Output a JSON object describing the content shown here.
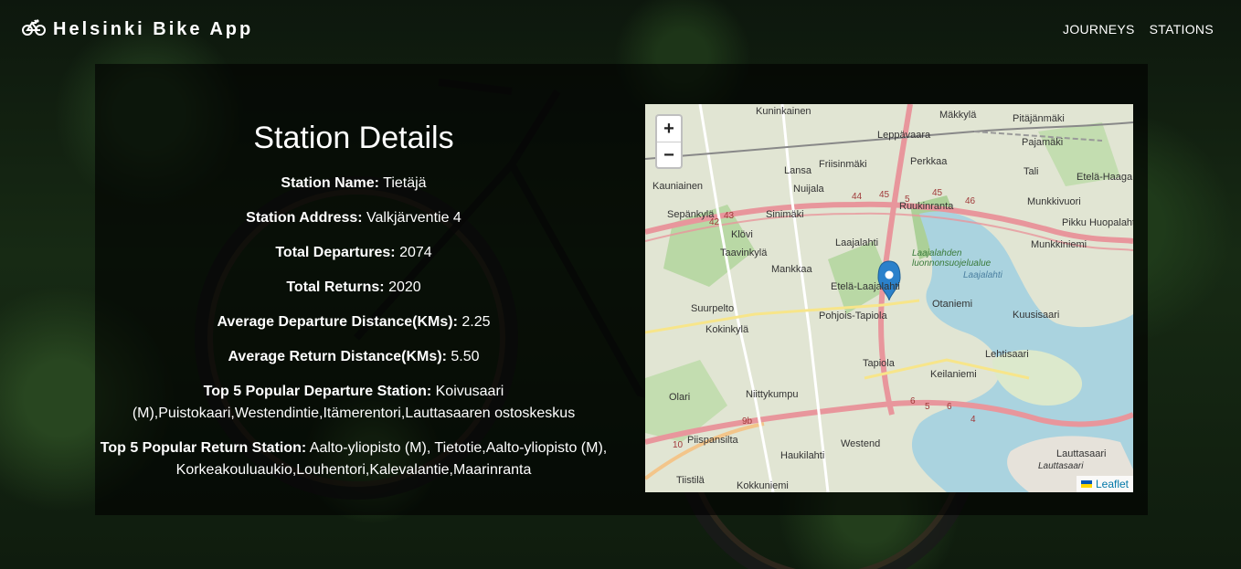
{
  "app": {
    "title": "Helsinki Bike App",
    "nav": [
      "JOURNEYS",
      "STATIONS"
    ]
  },
  "details": {
    "heading": "Station Details",
    "rows": [
      {
        "label": "Station Name:",
        "value": "Tietäjä"
      },
      {
        "label": "Station Address:",
        "value": "Valkjärventie 4"
      },
      {
        "label": "Total Departures:",
        "value": "2074"
      },
      {
        "label": "Total Returns:",
        "value": "2020"
      },
      {
        "label": "Average Departure Distance(KMs):",
        "value": "2.25"
      },
      {
        "label": "Average Return Distance(KMs):",
        "value": "5.50"
      },
      {
        "label": "Top 5 Popular Departure Station:",
        "value": "Koivusaari (M),Puistokaari,Westendintie,Itämerentori,Lauttasaaren ostoskeskus"
      },
      {
        "label": "Top 5 Popular Return Station:",
        "value": "Aalto-yliopisto (M), Tietotie,Aalto-yliopisto (M), Korkeakouluaukio,Louhentori,Kalevalantie,Maarinranta"
      }
    ]
  },
  "map": {
    "zoom_in": "+",
    "zoom_out": "−",
    "attribution": "Leaflet",
    "places": [
      "Kuninkainen",
      "Mäkkylä",
      "Pitäjänmäki",
      "Leppävaara",
      "Pajamäki",
      "Friisinmäki",
      "Perkkaa",
      "Lansa",
      "Tali",
      "Etelä-Haaga",
      "Kauniainen",
      "Nuijala",
      "Ruukinranta",
      "Munkkivuori",
      "Sepänkylä",
      "Sinimäki",
      "Pikku Huopalahti",
      "Klövi",
      "Laajalahti",
      "Taavinkylä",
      "Laajalahden luonnonsuojelualue",
      "Munkkiniemi",
      "Mankkaa",
      "Laajalahti",
      "Suurpelto",
      "Etelä-Laajalahti",
      "Otaniemi",
      "Kokinkylä",
      "Pohjois-Tapiola",
      "Kuusisaari",
      "Lehtisaari",
      "Tapiola",
      "Keilaniemi",
      "Olari",
      "Niittykumpu",
      "Piispansilta",
      "Haukilahti",
      "Westend",
      "Lauttasaari",
      "Tiistilä",
      "Kokkuniemi",
      "Lauttasaari"
    ],
    "road_numbers": [
      "42",
      "43",
      "44",
      "45",
      "46",
      "5",
      "45",
      "6",
      "5",
      "6",
      "4",
      "9b",
      "10"
    ]
  },
  "colors": {
    "panel_bg": "rgba(0,0,0,0.62)",
    "text": "#ffffff",
    "water": "#aad3df",
    "road": "#e8969c",
    "marker": "#2a81cb"
  }
}
